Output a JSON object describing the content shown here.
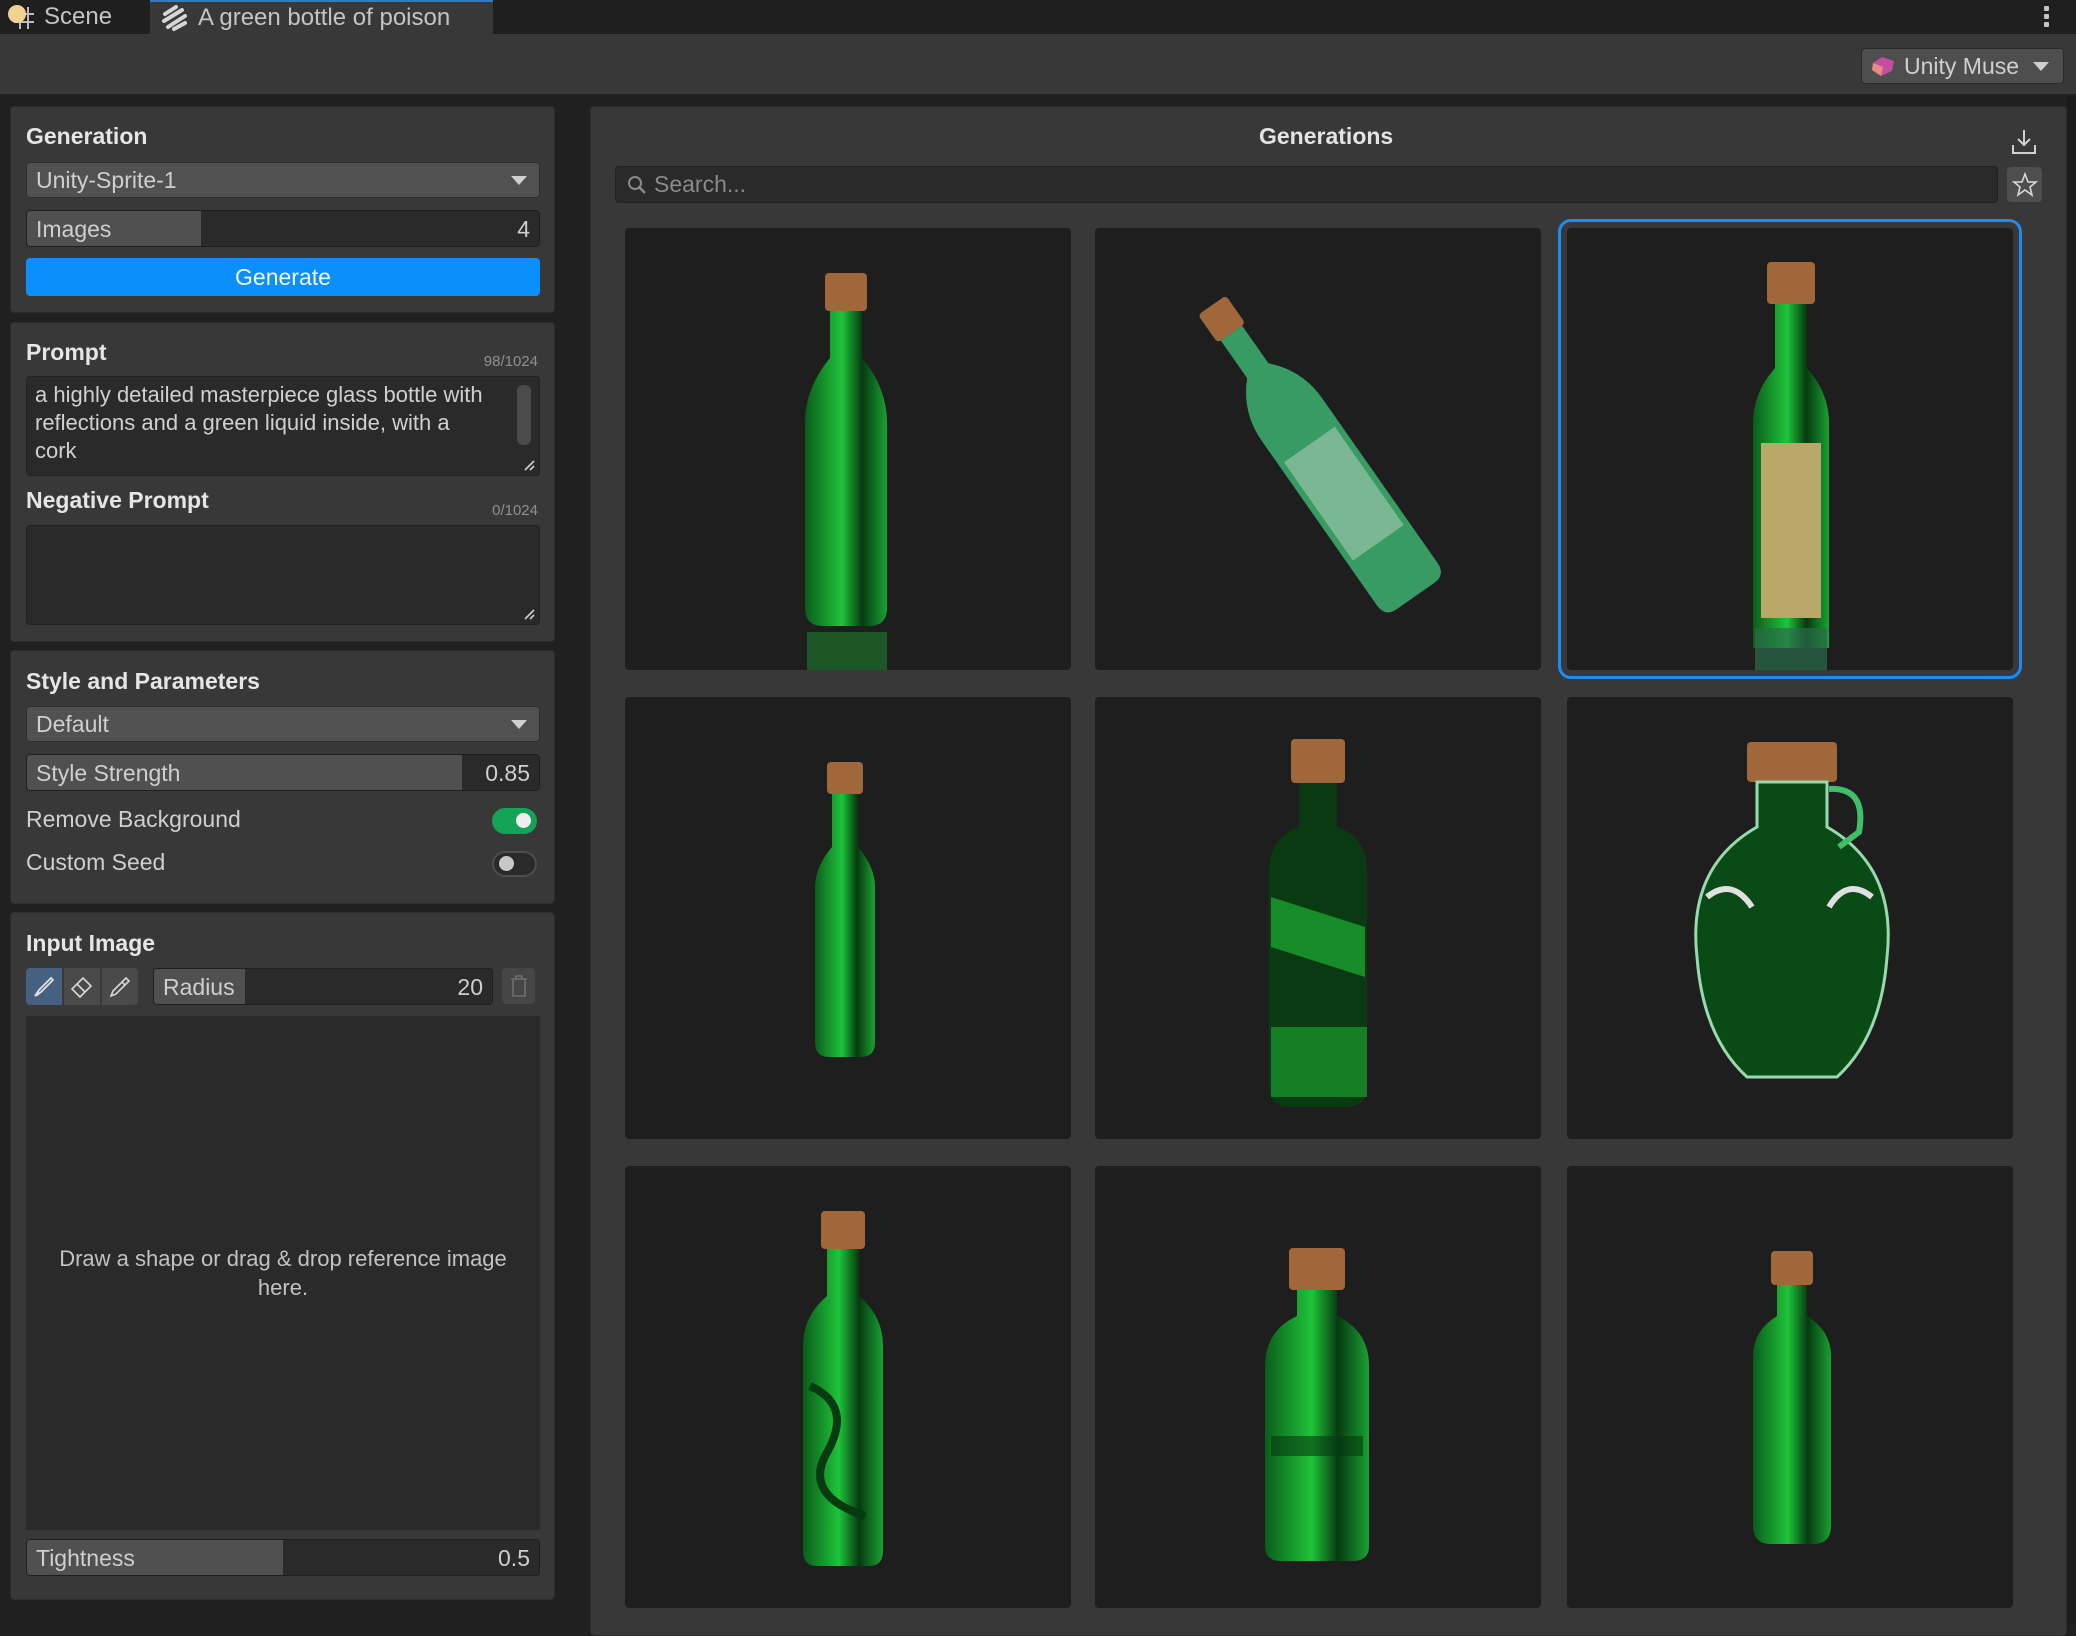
{
  "tabs": [
    {
      "label": "Scene",
      "icon": "scene-icon",
      "active": false
    },
    {
      "label": "A green bottle of poison",
      "icon": "muse-sprite-icon",
      "active": true
    }
  ],
  "toolbar": {
    "account_dropdown": {
      "label": "Unity Muse",
      "icon": "unity-muse-logo-icon"
    }
  },
  "generation": {
    "title": "Generation",
    "model": {
      "selected": "Unity-Sprite-1"
    },
    "images": {
      "label": "Images",
      "value": "4",
      "fill_fraction": 0.34
    },
    "generate_label": "Generate"
  },
  "prompt": {
    "title": "Prompt",
    "counter": "98/1024",
    "value": "a highly detailed masterpiece glass bottle with reflections and a green liquid inside, with a cork",
    "negative_title": "Negative Prompt",
    "negative_counter": "0/1024",
    "negative_value": ""
  },
  "style": {
    "title": "Style and Parameters",
    "style_selected": "Default",
    "strength": {
      "label": "Style Strength",
      "value": "0.85",
      "fill_fraction": 0.85
    },
    "remove_background": {
      "label": "Remove Background",
      "on": true
    },
    "custom_seed": {
      "label": "Custom Seed",
      "on": false
    }
  },
  "input_image": {
    "title": "Input Image",
    "tools": [
      {
        "name": "brush-tool",
        "icon": "brush-icon",
        "selected": true
      },
      {
        "name": "eraser-tool",
        "icon": "eraser-icon",
        "selected": false
      },
      {
        "name": "eyedropper-tool",
        "icon": "eyedropper-icon",
        "selected": false
      }
    ],
    "radius": {
      "label": "Radius",
      "value": "20",
      "fill_fraction": 0.27
    },
    "clear_icon": "trash-icon",
    "drop_hint": "Draw a shape or drag & drop reference image here.",
    "tightness": {
      "label": "Tightness",
      "value": "0.5",
      "fill_fraction": 0.5
    }
  },
  "generations": {
    "title": "Generations",
    "search_placeholder": "Search...",
    "export_icon": "download-icon",
    "favorites_icon": "star-icon",
    "selected_index": 2,
    "items": [
      {
        "description": "tall green bottle with cork and reflection",
        "variant": "tall"
      },
      {
        "description": "tilted bottle with ornate label",
        "variant": "tilted"
      },
      {
        "description": "green bottle with gold embossed label",
        "variant": "label"
      },
      {
        "description": "slim ornate green bottle",
        "variant": "slim"
      },
      {
        "description": "square dark green bottle",
        "variant": "square"
      },
      {
        "description": "round flask with handle and silver filigree",
        "variant": "flask"
      },
      {
        "description": "green bottle with swirl pattern",
        "variant": "swirl"
      },
      {
        "description": "short wide green bottle",
        "variant": "short"
      },
      {
        "description": "small glowing green bottle",
        "variant": "small"
      }
    ]
  },
  "colors": {
    "accent": "#0b8ffc",
    "selection": "#1c8cf5",
    "toggle_on": "#13a256",
    "liquid": "#1fc43a",
    "cork": "#a0673a"
  }
}
